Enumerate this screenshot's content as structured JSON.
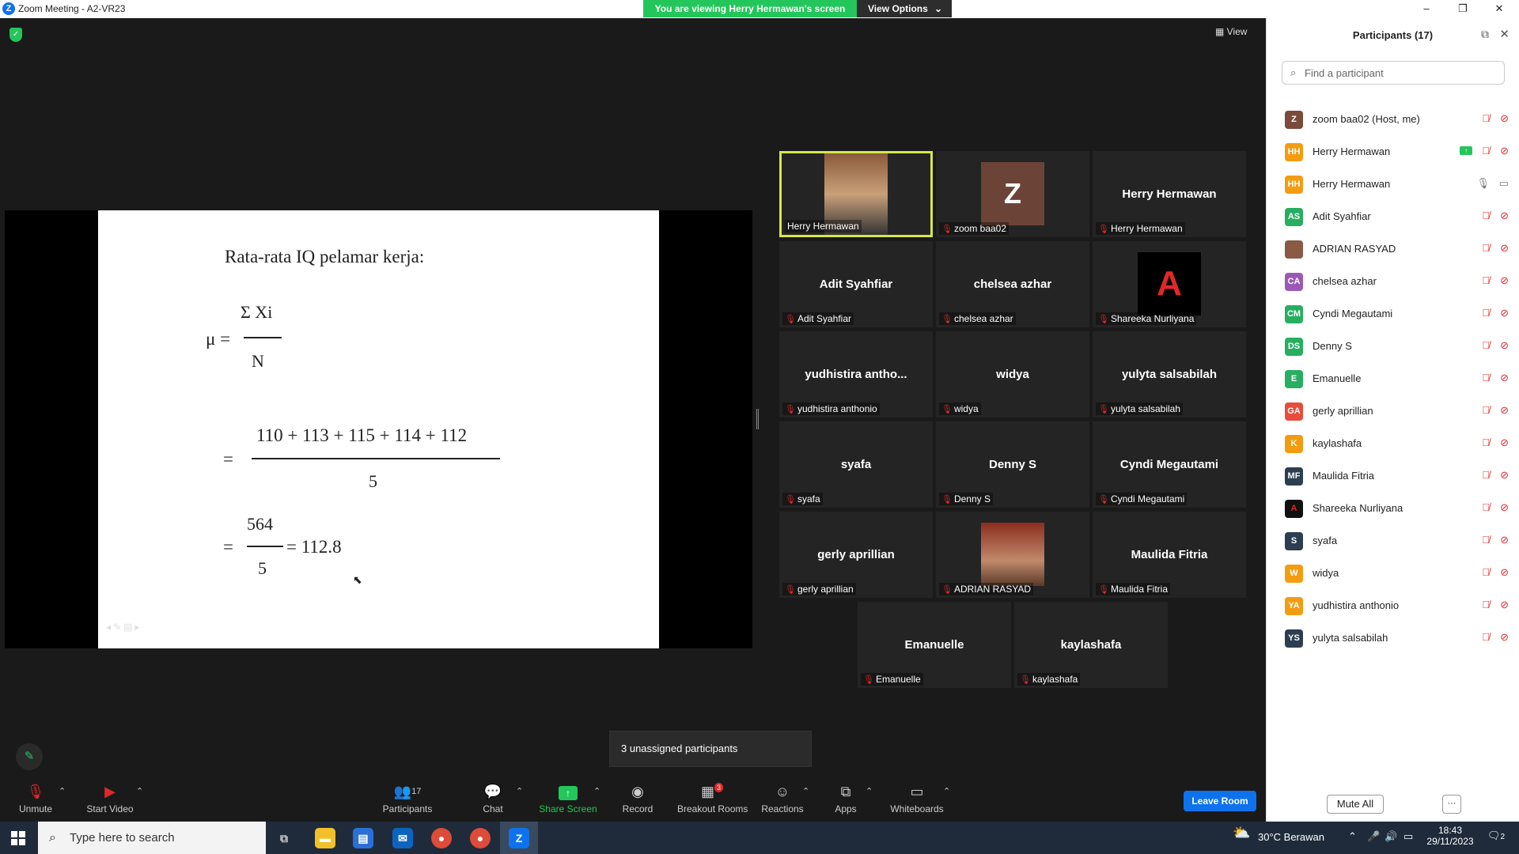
{
  "window": {
    "title": "Zoom Meeting - A2-VR23",
    "viewing_banner": "You are viewing Herry Hermawan's screen",
    "view_options": "View Options",
    "minimize": "–",
    "restore": "❐",
    "close": "✕"
  },
  "meeting": {
    "view_label": "View",
    "unassigned_toast": "3 unassigned participants"
  },
  "slide": {
    "heading": "Rata-rata IQ pelamar kerja:",
    "mu": "μ =",
    "sum_xi": "Σ Xi",
    "n": "N",
    "eq1": "=",
    "numerator": "110 + 113 + 115 + 114 + 112",
    "denominator": "5",
    "eq2": "=",
    "num2": "564",
    "den2": "5",
    "result": "= 112.8"
  },
  "tiles": [
    {
      "name": "",
      "label": "Herry Hermawan",
      "type": "video"
    },
    {
      "name": "",
      "label": "zoom baa02",
      "type": "avatar-z"
    },
    {
      "name": "Herry Hermawan",
      "label": "Herry Hermawan",
      "type": "name"
    },
    {
      "name": "Adit Syahfiar",
      "label": "Adit Syahfiar",
      "type": "name"
    },
    {
      "name": "chelsea azhar",
      "label": "chelsea azhar",
      "type": "name"
    },
    {
      "name": "",
      "label": "Shareeka Nurliyana",
      "type": "logo"
    },
    {
      "name": "yudhistira antho...",
      "label": "yudhistira anthonio",
      "type": "name"
    },
    {
      "name": "widya",
      "label": "widya",
      "type": "name"
    },
    {
      "name": "yulyta salsabilah",
      "label": "yulyta salsabilah",
      "type": "name"
    },
    {
      "name": "syafa",
      "label": "syafa",
      "type": "name"
    },
    {
      "name": "Denny S",
      "label": "Denny S",
      "type": "name"
    },
    {
      "name": "Cyndi Megautami",
      "label": "Cyndi Megautami",
      "type": "name"
    },
    {
      "name": "gerly aprillian",
      "label": "gerly aprillian",
      "type": "name"
    },
    {
      "name": "",
      "label": "ADRIAN RASYAD",
      "type": "photo"
    },
    {
      "name": "Maulida Fitria",
      "label": "Maulida Fitria",
      "type": "name"
    },
    {
      "name": "Emanuelle",
      "label": "Emanuelle",
      "type": "name"
    },
    {
      "name": "kaylashafa",
      "label": "kaylashafa",
      "type": "name"
    }
  ],
  "toolbar": {
    "unmute": "Unmute",
    "start_video": "Start Video",
    "participants": "Participants",
    "participants_count": "17",
    "chat": "Chat",
    "share_screen": "Share Screen",
    "record": "Record",
    "breakout_rooms": "Breakout Rooms",
    "breakout_badge": "3",
    "reactions": "Reactions",
    "apps": "Apps",
    "whiteboards": "Whiteboards",
    "leave_room": "Leave Room"
  },
  "panel": {
    "title": "Participants (17)",
    "search_placeholder": "Find a participant",
    "mute_all": "Mute All",
    "more": "···",
    "participants": [
      {
        "initials": "Z",
        "name": "zoom baa02 (Host, me)",
        "color": "#7a4a3a"
      },
      {
        "initials": "HH",
        "name": "Herry Hermawan",
        "color": "#f39c12",
        "sharing": true
      },
      {
        "initials": "HH",
        "name": "Herry Hermawan",
        "color": "#f39c12",
        "unmuted": true
      },
      {
        "initials": "AS",
        "name": "Adit Syahfiar",
        "color": "#27ae60"
      },
      {
        "initials": "",
        "name": "ADRIAN RASYAD",
        "color": "#8a5a44",
        "photo": true
      },
      {
        "initials": "CA",
        "name": "chelsea azhar",
        "color": "#9b59b6"
      },
      {
        "initials": "CM",
        "name": "Cyndi Megautami",
        "color": "#27ae60"
      },
      {
        "initials": "DS",
        "name": "Denny S",
        "color": "#27ae60"
      },
      {
        "initials": "E",
        "name": "Emanuelle",
        "color": "#27ae60"
      },
      {
        "initials": "GA",
        "name": "gerly aprillian",
        "color": "#e74c3c"
      },
      {
        "initials": "K",
        "name": "kaylashafa",
        "color": "#f39c12"
      },
      {
        "initials": "MF",
        "name": "Maulida Fitria",
        "color": "#2c3e50"
      },
      {
        "initials": "",
        "name": "Shareeka Nurliyana",
        "color": "#111111",
        "logo": true
      },
      {
        "initials": "S",
        "name": "syafa",
        "color": "#2c3e50"
      },
      {
        "initials": "W",
        "name": "widya",
        "color": "#f39c12"
      },
      {
        "initials": "YA",
        "name": "yudhistira anthonio",
        "color": "#f39c12"
      },
      {
        "initials": "YS",
        "name": "yulyta salsabilah",
        "color": "#2c3e50"
      }
    ]
  },
  "taskbar": {
    "search_placeholder": "Type here to search",
    "weather": "30°C Berawan",
    "time": "18:43",
    "date": "29/11/2023",
    "notifications": "2"
  }
}
